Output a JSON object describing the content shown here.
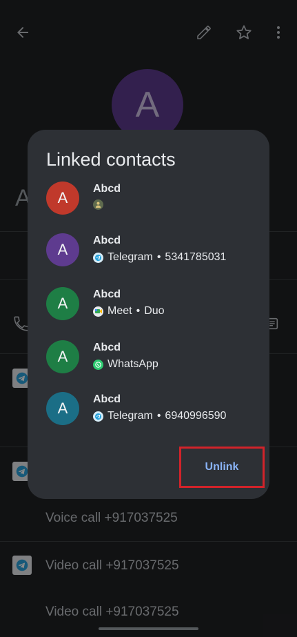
{
  "background": {
    "avatar_letter": "A",
    "name_partial": "A",
    "rows": [
      {
        "text": "Voice call +917037525"
      },
      {
        "text": "Video call +917037525"
      },
      {
        "text": "Video call +917037525"
      }
    ]
  },
  "dialog": {
    "title": "Linked contacts",
    "contacts": [
      {
        "letter": "A",
        "name": "Abcd",
        "app": "",
        "detail": "",
        "color": "#c0392b",
        "app_icon": "google-contacts-icon"
      },
      {
        "letter": "A",
        "name": "Abcd",
        "app": "Telegram",
        "detail": "5341785031",
        "color": "#5e3b8f",
        "app_icon": "telegram-icon"
      },
      {
        "letter": "A",
        "name": "Abcd",
        "app": "Meet",
        "detail": "Duo",
        "color": "#1e7e45",
        "app_icon": "meet-icon"
      },
      {
        "letter": "A",
        "name": "Abcd",
        "app": "WhatsApp",
        "detail": "",
        "color": "#1e7e45",
        "app_icon": "whatsapp-icon"
      },
      {
        "letter": "A",
        "name": "Abcd",
        "app": "Telegram",
        "detail": "6940996590",
        "color": "#1b6e86",
        "app_icon": "telegram-icon"
      }
    ],
    "unlink_label": "Unlink"
  },
  "colors": {
    "background": "#202124",
    "dialog": "#2d3035",
    "accent": "#8ab4f8",
    "highlight": "#d2232a"
  }
}
